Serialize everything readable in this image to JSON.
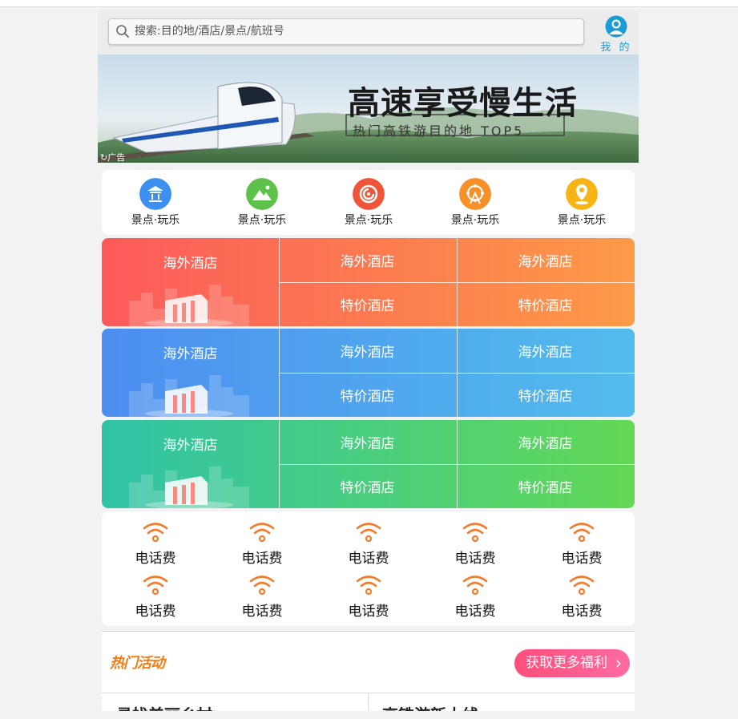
{
  "search": {
    "placeholder": "搜索:目的地/酒店/景点/航班号"
  },
  "profile": {
    "label": "我 的"
  },
  "banner": {
    "title": "高速享受慢生活",
    "subtitle": "热门高铁游目的地 TOP5",
    "ad_tag": "广告"
  },
  "quick_nav": [
    {
      "label": "景点·玩乐",
      "icon": "temple-icon",
      "color": "#3d8ff0"
    },
    {
      "label": "景点·玩乐",
      "icon": "mountain-icon",
      "color": "#5cc24a"
    },
    {
      "label": "景点·玩乐",
      "icon": "ticket-icon",
      "color": "#f0553a"
    },
    {
      "label": "景点·玩乐",
      "icon": "ferris-wheel-icon",
      "color": "#f79028"
    },
    {
      "label": "景点·玩乐",
      "icon": "location-pin-icon",
      "color": "#f8b315"
    }
  ],
  "hotel_groups": [
    {
      "theme": "orange",
      "big_label": "海外酒店",
      "top": [
        "海外酒店",
        "海外酒店"
      ],
      "bottom": [
        "特价酒店",
        "特价酒店"
      ],
      "colors": [
        "#fc5a5a",
        "#fd9a47"
      ]
    },
    {
      "theme": "blue",
      "big_label": "海外酒店",
      "top": [
        "海外酒店",
        "海外酒店"
      ],
      "bottom": [
        "特价酒店",
        "特价酒店"
      ],
      "colors": [
        "#4d8ef0",
        "#52bcec"
      ]
    },
    {
      "theme": "green",
      "big_label": "海外酒店",
      "top": [
        "海外酒店",
        "海外酒店"
      ],
      "bottom": [
        "特价酒店",
        "特价酒店"
      ],
      "colors": [
        "#30c3a7",
        "#63d856"
      ]
    }
  ],
  "phone_items": [
    {
      "label": "电话费"
    },
    {
      "label": "电话费"
    },
    {
      "label": "电话费"
    },
    {
      "label": "电话费"
    },
    {
      "label": "电话费"
    },
    {
      "label": "电话费"
    },
    {
      "label": "电话费"
    },
    {
      "label": "电话费"
    },
    {
      "label": "电话费"
    },
    {
      "label": "电话费"
    }
  ],
  "hot_section": {
    "title": "热门活动",
    "button": "获取更多福利",
    "cards": [
      "寻找美丽乡村",
      "高铁游新大线"
    ]
  },
  "colors": {
    "accent_blue": "#1a9cd8",
    "wifi_orange": "#f47a2a",
    "hot_pink": "#ff4f7b"
  }
}
